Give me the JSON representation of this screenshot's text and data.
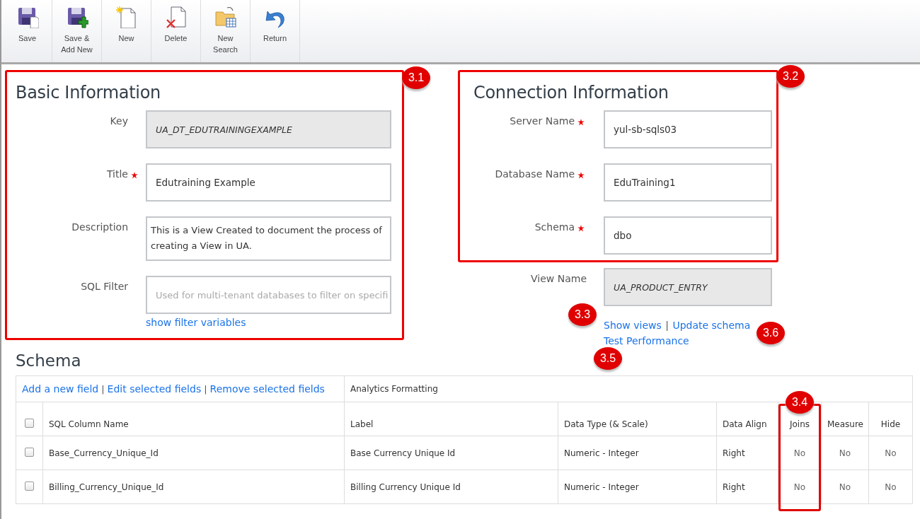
{
  "toolbar": {
    "buttons": [
      {
        "label": "Save"
      },
      {
        "label": "Save & Add New"
      },
      {
        "label": "New"
      },
      {
        "label": "Delete"
      },
      {
        "label": "New Search"
      },
      {
        "label": "Return"
      }
    ]
  },
  "basic_information": {
    "title": "Basic Information",
    "callout": "3.1",
    "fields": [
      {
        "label": "Key",
        "required": false,
        "kind": "readonly",
        "value": "UA_DT_EDUTRAININGEXAMPLE"
      },
      {
        "label": "Title",
        "required": true,
        "kind": "text",
        "value": "Edutraining Example"
      },
      {
        "label": "Description",
        "required": false,
        "kind": "textarea",
        "value": "This is a View Created to document the process of creating a View in UA."
      },
      {
        "label": "SQL Filter",
        "required": false,
        "kind": "text",
        "placeholder": "Used for multi-tenant databases to filter on specifi"
      }
    ],
    "link": "show filter variables"
  },
  "connection_information": {
    "title": "Connection Information",
    "callout": "3.2",
    "fields": [
      {
        "label": "Server Name",
        "required": true,
        "kind": "text",
        "value": "yul-sb-sqls03"
      },
      {
        "label": "Database Name",
        "required": true,
        "kind": "text",
        "value": "EduTraining1"
      },
      {
        "label": "Schema",
        "required": true,
        "kind": "text",
        "value": "dbo"
      }
    ]
  },
  "view_name": {
    "label": "View Name",
    "kind": "readonly",
    "value": "UA_PRODUCT_ENTRY",
    "links": [
      {
        "kind": "link",
        "label": "Show views",
        "callout": "3.3"
      },
      {
        "kind": "separator",
        "label": "|"
      },
      {
        "kind": "link",
        "label": "Update schema",
        "callout": "3.6"
      },
      {
        "kind": "link",
        "label": "Test Performance",
        "callout": "3.5"
      }
    ]
  },
  "schema": {
    "title": "Schema",
    "actions": [
      {
        "kind": "link",
        "label": "Add a new field"
      },
      {
        "kind": "separator",
        "label": "|"
      },
      {
        "kind": "link",
        "label": "Edit selected fields"
      },
      {
        "kind": "separator",
        "label": "|"
      },
      {
        "kind": "link",
        "label": "Remove selected fields"
      }
    ],
    "group_label": "Analytics Formatting",
    "select_all_checked": false,
    "columns": [
      {
        "label": "SQL Column Name",
        "highlighted": false
      },
      {
        "label": "Label",
        "highlighted": false
      },
      {
        "label": "Data Type (& Scale)",
        "highlighted": false
      },
      {
        "label": "Data Align",
        "highlighted": false
      },
      {
        "label": "Joins",
        "highlighted": true,
        "callout": "3.4"
      },
      {
        "label": "Measure",
        "highlighted": false
      },
      {
        "label": "Hide",
        "highlighted": false
      }
    ],
    "rows": [
      {
        "checked": false,
        "cells": [
          "Base_Currency_Unique_Id",
          "Base Currency Unique Id",
          "Numeric - Integer",
          "Right",
          "No",
          "No",
          "No"
        ]
      },
      {
        "checked": false,
        "cells": [
          "Billing_Currency_Unique_Id",
          "Billing Currency Unique Id",
          "Numeric - Integer",
          "Right",
          "No",
          "No",
          "No"
        ]
      }
    ]
  }
}
